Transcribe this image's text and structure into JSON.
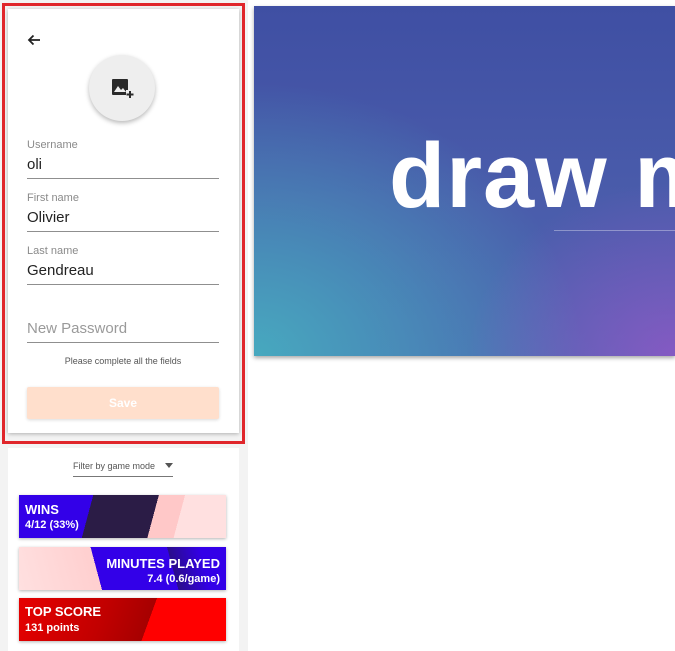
{
  "profile": {
    "back_icon": "arrow-back-icon",
    "avatar_icon": "add-photo-icon",
    "fields": {
      "username": {
        "label": "Username",
        "value": "oli"
      },
      "first_name": {
        "label": "First name",
        "value": "Olivier"
      },
      "last_name": {
        "label": "Last name",
        "value": "Gendreau"
      },
      "new_password": {
        "placeholder": "New Password"
      }
    },
    "helper_text": "Please complete all the fields",
    "save_label": "Save"
  },
  "stats": {
    "filter_placeholder": "Filter by game mode",
    "cards": {
      "wins": {
        "title": "WINS",
        "value": "4/12 (33%)"
      },
      "minutes": {
        "title": "MINUTES PLAYED",
        "value": "7.4 (0.6/game)"
      },
      "score": {
        "title": "TOP SCORE",
        "value": "131 points"
      }
    }
  },
  "hero": {
    "title": "draw m"
  },
  "colors": {
    "highlight": "#e0262b",
    "save_disabled": "#ffdfcc",
    "wins_accent": "#3300e8",
    "score_accent": "#e60000"
  }
}
